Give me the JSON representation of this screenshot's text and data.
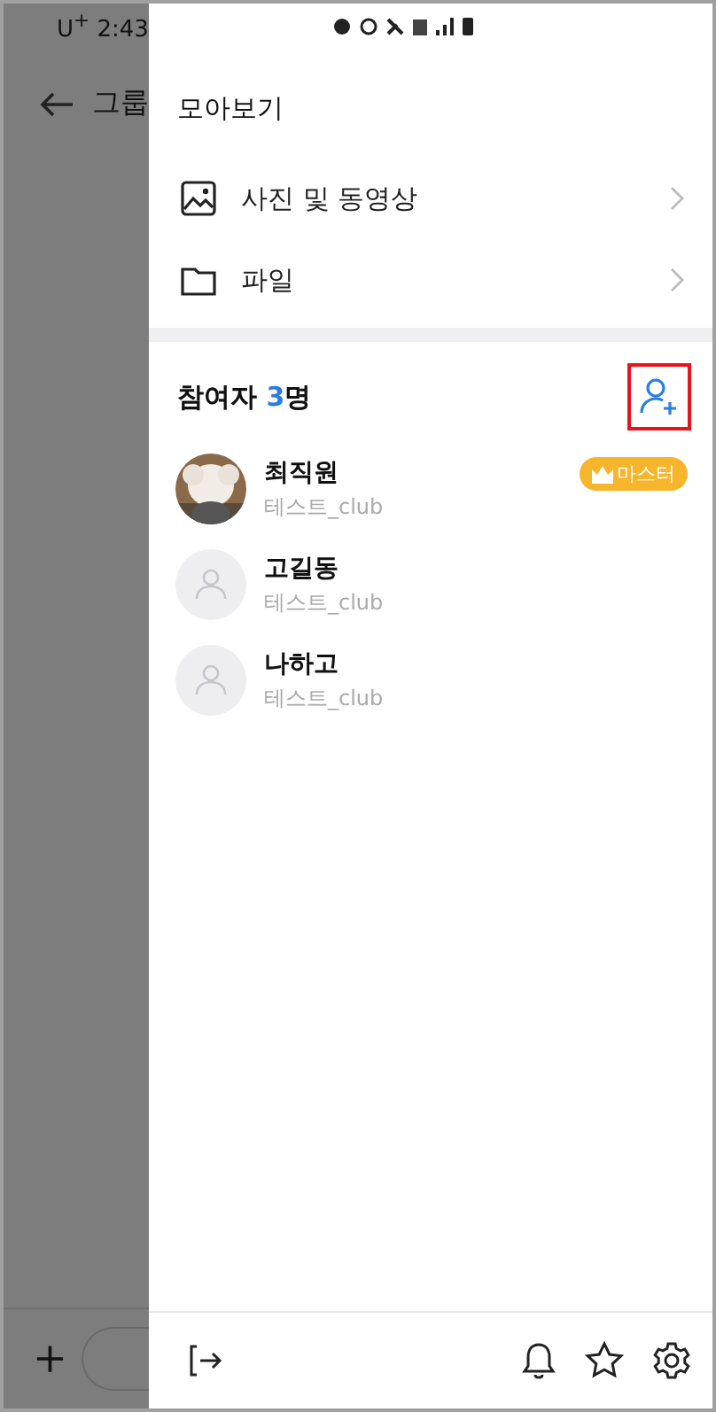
{
  "status_bar": {
    "carrier": "U$^{+}$",
    "time": "2:43"
  },
  "background_screen": {
    "title": "그룹"
  },
  "drawer": {
    "title": "모아보기",
    "menu": [
      {
        "kind": "media",
        "label": "사진 및 동영상"
      },
      {
        "kind": "file",
        "label": "파일"
      }
    ],
    "participants": {
      "label": "참여자",
      "count": "3",
      "unit": "명",
      "add_button": {
        "highlighted": true
      }
    },
    "members": [
      {
        "name": "최직원",
        "club": "테스트_club",
        "badge": "마스터"
      },
      {
        "name": "고길동",
        "club": "테스트_club",
        "kind": "default"
      },
      {
        "name": "나하고",
        "club": "테스트_club",
        "kind": "default"
      }
    ]
  }
}
